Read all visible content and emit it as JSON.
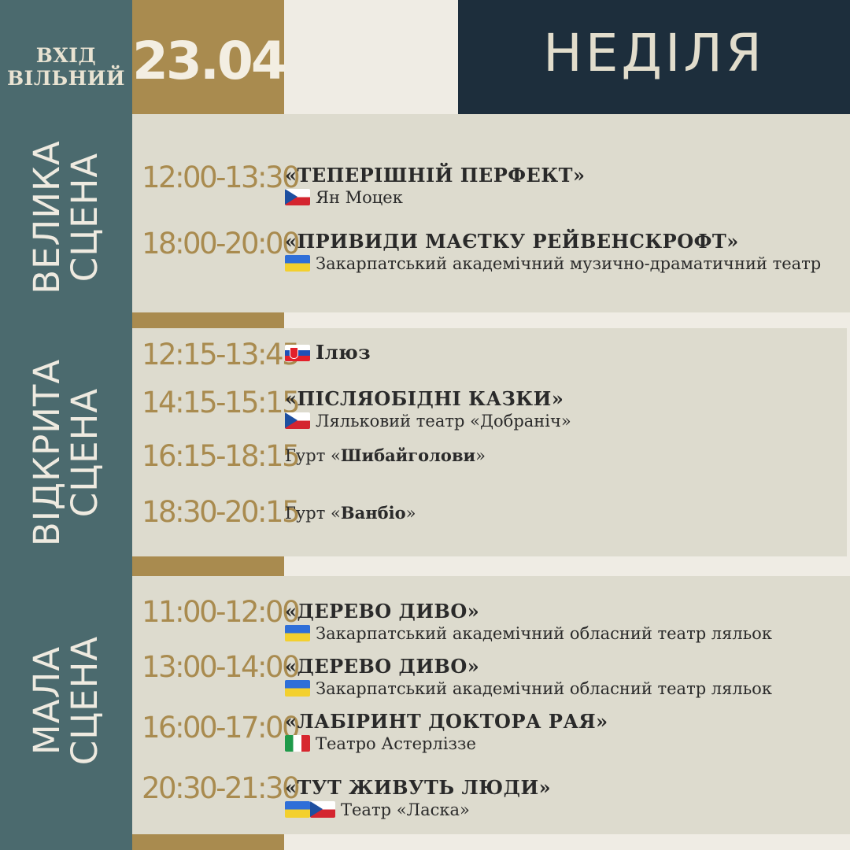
{
  "header": {
    "free_entry_line1": "ВХІД",
    "free_entry_line2": "ВІЛЬНИЙ",
    "date": "23.04",
    "day": "НЕДІЛЯ"
  },
  "stages": [
    {
      "label_line1": "ВЕЛИКА",
      "label_line2": "СЦЕНА",
      "events": [
        {
          "time": "12:00-13:30",
          "title": "«ТЕПЕРІШНІЙ ПЕРФЕКТ»",
          "flags": [
            "czech-flag-icon"
          ],
          "sub": "Ян Моцек"
        },
        {
          "time": "18:00-20:00",
          "title": "«ПРИВИДИ МАЄТКУ РЕЙВЕНСКРОФТ»",
          "flags": [
            "ukraine-flag-icon"
          ],
          "sub": "Закарпатський академічний музично-драматичний театр"
        }
      ]
    },
    {
      "label_line1": "ВІДКРИТА",
      "label_line2": "СЦЕНА",
      "events": [
        {
          "time": "12:15-13:45",
          "flags": [
            "slovakia-flag-icon"
          ],
          "title": "Ілюз"
        },
        {
          "time": "14:15-15:15",
          "title": "«ПІСЛЯОБІДНІ КАЗКИ»",
          "flags": [
            "czech-flag-icon"
          ],
          "sub": "Ляльковий театр «Добраніч»"
        },
        {
          "time": "16:15-18:15",
          "prefix": "Гурт «",
          "name": "Шибайголови",
          "suffix": "»"
        },
        {
          "time": "18:30-20:15",
          "prefix": "Гурт «",
          "name": "Ванбіо",
          "suffix": "»"
        }
      ]
    },
    {
      "label_line1": "МАЛА",
      "label_line2": "СЦЕНА",
      "events": [
        {
          "time": "11:00-12:00",
          "title": "«ДЕРЕВО ДИВО»",
          "flags": [
            "ukraine-flag-icon"
          ],
          "sub": "Закарпатський академічний обласний театр ляльок"
        },
        {
          "time": "13:00-14:00",
          "title": "«ДЕРЕВО ДИВО»",
          "flags": [
            "ukraine-flag-icon"
          ],
          "sub": "Закарпатський академічний обласний театр ляльок"
        },
        {
          "time": "16:00-17:00",
          "title": "«ЛАБІРИНТ ДОКТОРА РАЯ»",
          "flags": [
            "italy-flag-icon"
          ],
          "sub": "Театро Астерліззе"
        },
        {
          "time": "20:30-21:30",
          "title": "«ТУТ ЖИВУТЬ ЛЮДИ»",
          "flags": [
            "ukraine-flag-icon",
            "czech-flag-icon"
          ],
          "sub": "Театр «Ласка»"
        }
      ]
    }
  ],
  "colors": {
    "sidebar": "#4b6a6e",
    "gold": "#a98b4f",
    "navy": "#1d2e3c",
    "panel": "#dddbce",
    "background": "#efece4",
    "text": "#2a2a2a"
  }
}
